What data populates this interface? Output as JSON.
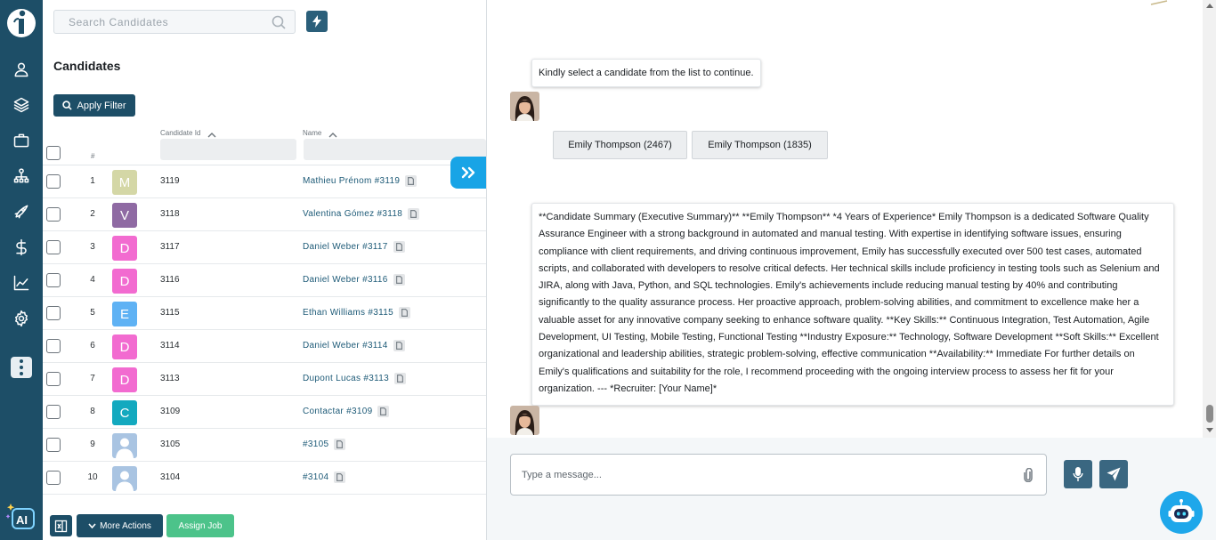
{
  "sidebar": {
    "items": [
      {
        "name": "user-icon"
      },
      {
        "name": "layers-icon"
      },
      {
        "name": "briefcase-icon"
      },
      {
        "name": "org-chart-icon"
      },
      {
        "name": "rocket-icon"
      },
      {
        "name": "dollar-icon"
      },
      {
        "name": "analytics-icon"
      },
      {
        "name": "gear-icon"
      }
    ],
    "more_icon": "vertical-dots-icon",
    "ai_label": "AI"
  },
  "list": {
    "search_placeholder": "Search Candidates",
    "title": "Candidates",
    "apply_filter_label": "Apply Filter",
    "columns": {
      "index": "#",
      "candidate_id": "Candidate Id",
      "name": "Name"
    },
    "rows": [
      {
        "index": "1",
        "avatar": "M",
        "avatar_color": "#d4d7a6",
        "id": "3119",
        "name": "Mathieu Prénom #3119"
      },
      {
        "index": "2",
        "avatar": "V",
        "avatar_color": "#8f6aa3",
        "id": "3118",
        "name": "Valentina Gómez #3118"
      },
      {
        "index": "3",
        "avatar": "D",
        "avatar_color": "#f26bd0",
        "id": "3117",
        "name": "Daniel Weber #3117"
      },
      {
        "index": "4",
        "avatar": "D",
        "avatar_color": "#f26bd0",
        "id": "3116",
        "name": "Daniel Weber #3116"
      },
      {
        "index": "5",
        "avatar": "E",
        "avatar_color": "#5fb2f4",
        "id": "3115",
        "name": "Ethan Williams #3115"
      },
      {
        "index": "6",
        "avatar": "D",
        "avatar_color": "#f26bd0",
        "id": "3114",
        "name": "Daniel Weber #3114"
      },
      {
        "index": "7",
        "avatar": "D",
        "avatar_color": "#f26bd0",
        "id": "3113",
        "name": "Dupont Lucas #3113"
      },
      {
        "index": "8",
        "avatar": "C",
        "avatar_color": "#13a9bf",
        "id": "3109",
        "name": "Contactar #3109"
      },
      {
        "index": "9",
        "avatar": "",
        "avatar_color": "#a9c4e2",
        "id": "3105",
        "name": "#3105"
      },
      {
        "index": "10",
        "avatar": "",
        "avatar_color": "#a9c4e2",
        "id": "3104",
        "name": "#3104"
      }
    ],
    "actions": {
      "more_actions_label": "More Actions",
      "assign_job_label": "Assign Job"
    }
  },
  "chat": {
    "prompt_message": "Kindly select a candidate from the list to continue.",
    "options": [
      "Emily Thompson (2467)",
      "Emily Thompson (1835)"
    ],
    "summary": "**Candidate Summary (Executive Summary)** **Emily Thompson** *4 Years of Experience* Emily Thompson is a dedicated Software Quality Assurance Engineer with a strong background in automated and manual testing. With expertise in identifying software issues, ensuring compliance with client requirements, and driving continuous improvement, Emily has successfully executed over 500 test cases, automated scripts, and collaborated with developers to resolve critical defects. Her technical skills include proficiency in testing tools such as Selenium and JIRA, along with Java, Python, and SQL technologies. Emily's achievements include reducing manual testing by 40% and contributing significantly to the quality assurance process. Her proactive approach, problem-solving abilities, and commitment to excellence make her a valuable asset for any innovative company seeking to enhance software quality. **Key Skills:** Continuous Integration, Test Automation, Agile Development, UI Testing, Mobile Testing, Functional Testing **Industry Exposure:** Technology, Software Development **Soft Skills:** Excellent organizational and leadership abilities, strategic problem-solving, effective communication **Availability:** Immediate For further details on Emily's qualifications and suitability for the role, I recommend proceeding with the ongoing interview process to assess her fit for your organization. --- *Recruiter: [Your Name]*",
    "input_placeholder": "Type a message..."
  },
  "colors": {
    "rail": "#1d4e67",
    "primary_button": "#1d4e67",
    "assign_button": "#4cc38a",
    "link": "#1d5a77",
    "accent": "#18a4e6"
  }
}
